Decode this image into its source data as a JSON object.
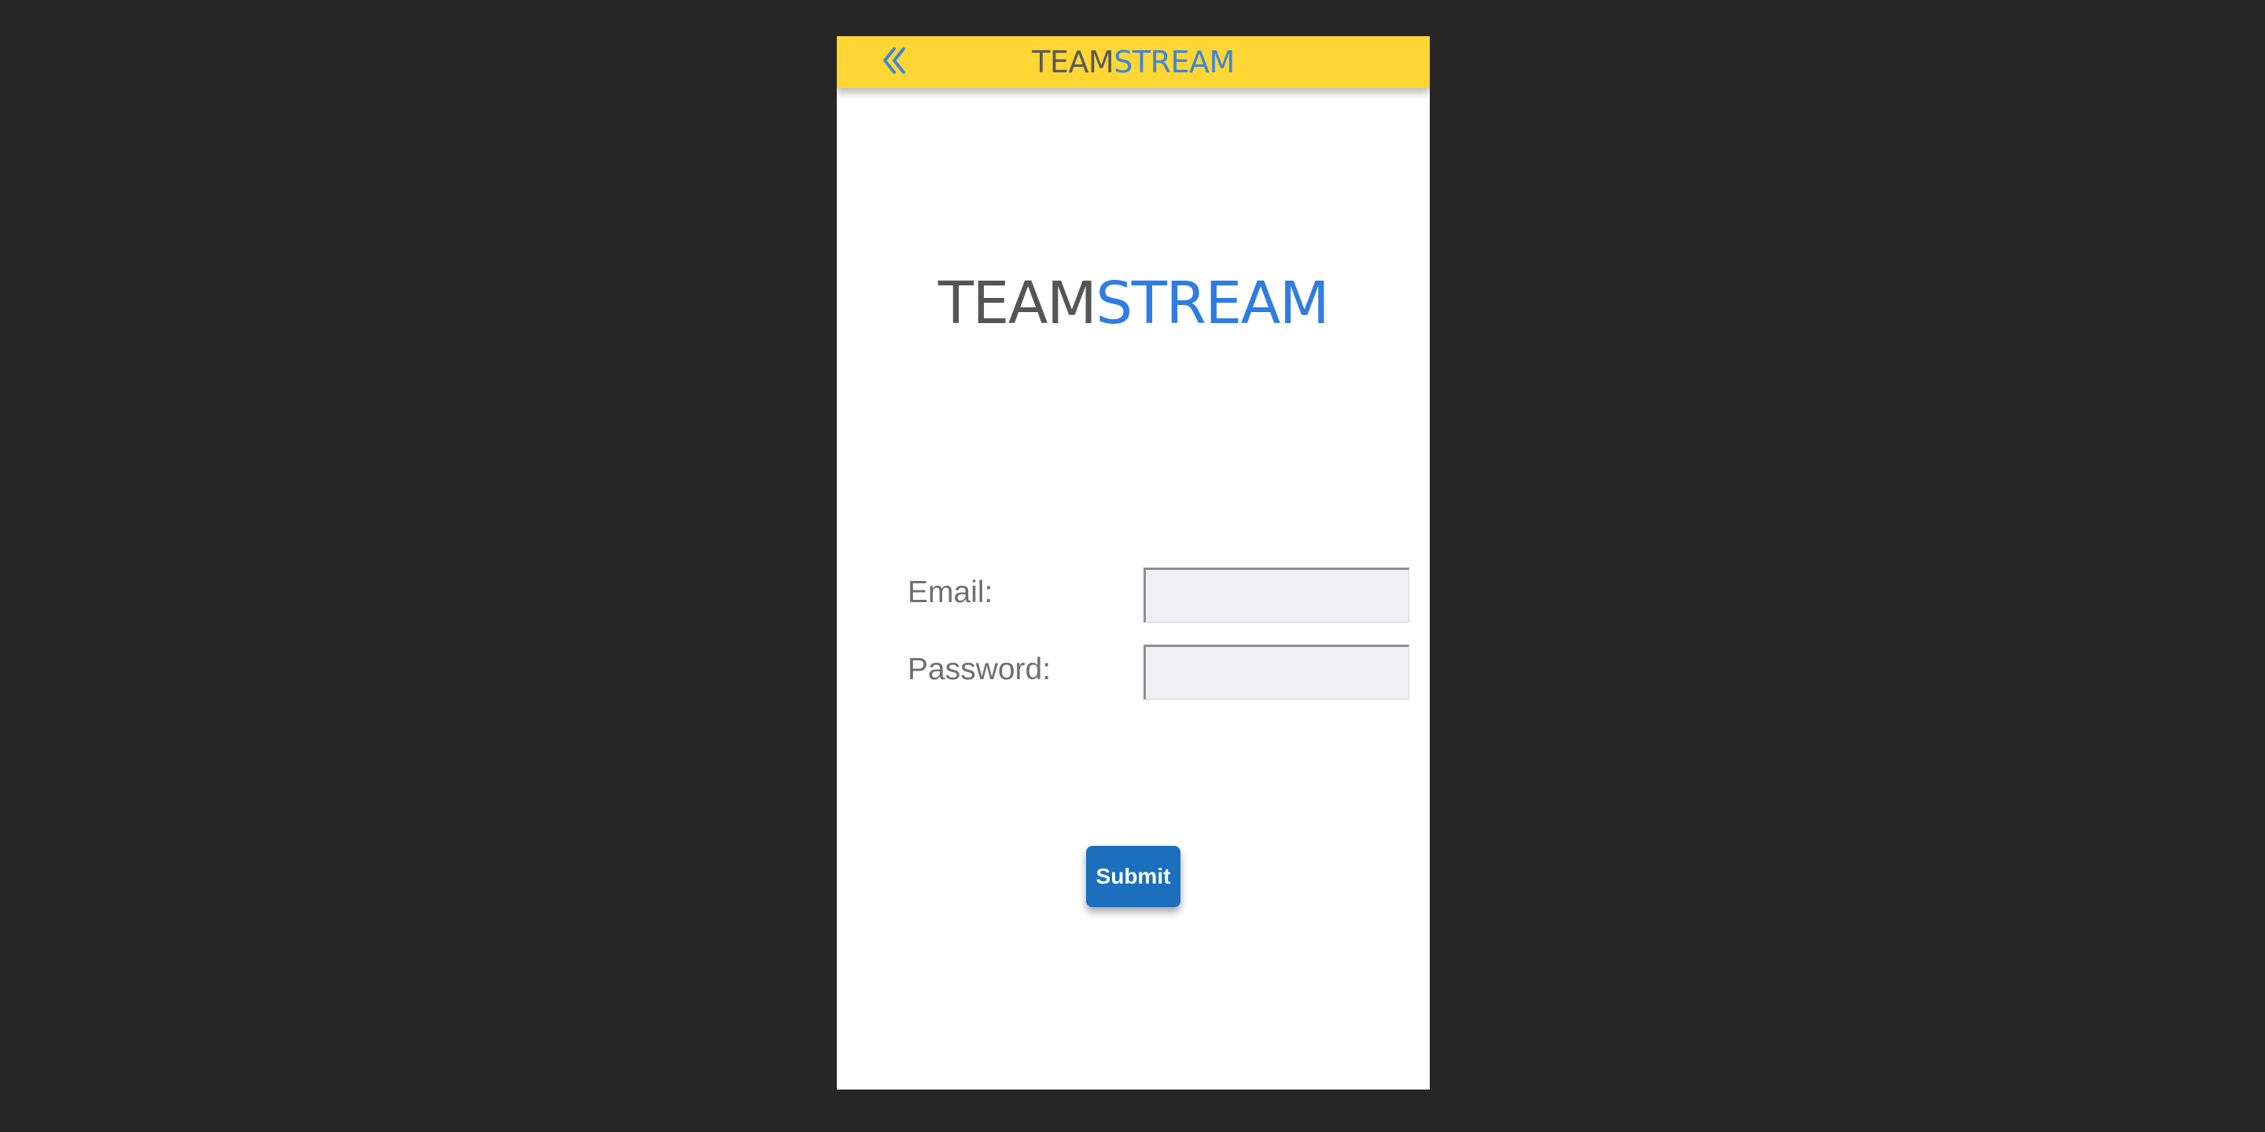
{
  "header": {
    "back_icon": "double-chevron-left-icon",
    "brand_part1": "TEAM",
    "brand_part2": "STREAM",
    "background_color": "#ffd633",
    "accent_color": "#3d86d8"
  },
  "logo": {
    "part1": "TEAM",
    "part2": "STREAM",
    "part1_color": "#555555",
    "part2_color": "#2f7de1"
  },
  "form": {
    "email_label": "Email:",
    "email_value": "",
    "password_label": "Password:",
    "password_value": "",
    "submit_label": "Submit",
    "submit_color": "#1b6fbd"
  },
  "colors": {
    "page_background": "#262626",
    "screen_background": "#ffffff"
  }
}
